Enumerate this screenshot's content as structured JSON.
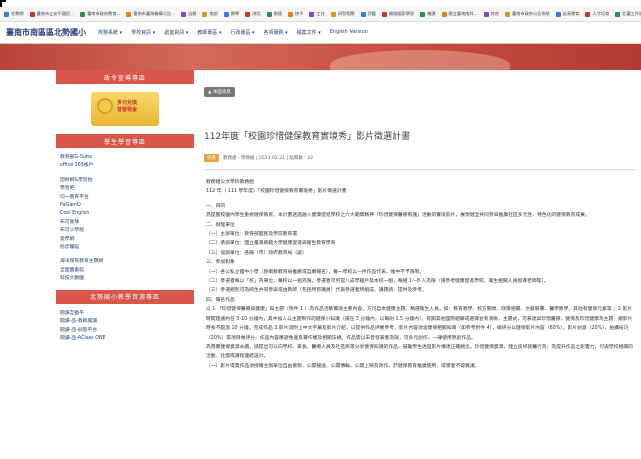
{
  "bookmarks": [
    {
      "label": "北教網"
    },
    {
      "label": "臺南市立安平國民..."
    },
    {
      "label": "臺南市政府教育..."
    },
    {
      "label": "臺南市臺灣機構公告..."
    },
    {
      "label": "自救"
    },
    {
      "label": "南部"
    },
    {
      "label": "教學"
    },
    {
      "label": "湖北"
    },
    {
      "label": "樹德"
    },
    {
      "label": "快平"
    },
    {
      "label": "工作"
    },
    {
      "label": "研習相關"
    },
    {
      "label": "評鑑"
    },
    {
      "label": "開發國家學習"
    },
    {
      "label": "補課"
    },
    {
      "label": "國立臺南南科..."
    },
    {
      "label": "其他"
    },
    {
      "label": "臺南市政府公告系統"
    },
    {
      "label": "延長教育"
    },
    {
      "label": "人才培育"
    },
    {
      "label": "北臺工作區"
    }
  ],
  "site": {
    "title": "臺南市南區區北勢國小",
    "nav": [
      "校務系統 ▾",
      "學校資訊 ▾",
      "處室資訊 ▾",
      "教師專區 ▾",
      "行政專區 ▾",
      "各項服務 ▾",
      "檔案文件 ▾",
      "English Version"
    ]
  },
  "sidebar": {
    "promo_head": "政令宣導專區",
    "promo_text_1": "多元兌換",
    "promo_text_2": "普發現金",
    "learn_head": "學生學習專區",
    "learn_links": [
      "教育部G-Suite",
      "office 365帳戶",
      "",
      "因材網&學習拍",
      "學習吧",
      "均一教育平台",
      "PaGamO",
      "Cool English",
      "布可星球",
      "布可小學版",
      "愛學網",
      "防詐騙館",
      "",
      "海洋保育教育主題網",
      "全國圖書館",
      "科技大觀園"
    ],
    "teacher_head": "北勢國小教學資源專區",
    "teacher_links": [
      "閱讀互動平",
      "閱讀-品-教師閱讀",
      "閱讀-品-創思平台",
      "閱讀-品-AClass ONE"
    ]
  },
  "main": {
    "crumb": "▲ 本區訊息",
    "title": "112年度「校園珍惜健保教育實境秀」影片徵選計畫",
    "tag": "訊息",
    "meta": "教務處 - 學務組 | 2023-02-21 | 點閱數：22",
    "body": [
      "教務組公文學校教務組",
      "112 年（ 111 學年度）「校園珍惜健保教育實境秀」影片徵選計畫",
      "一、目的",
      "為提醒校園內學生重視健保教育，本計畫透過融入健康促進學校之六大範疇精神「珍惜健保醫療照護」活動的實境影片，展現健全共同參與推廣社區多元性、特色化的健保教育成果。",
      "二、辦理單位",
      "（一）主辦單位：教育部國民及學前教育署",
      "（二）承辦單位：國立臺灣師範大學健康促進與衛生教育學系",
      "（三）協辦單位：各縣（市）政府教育局（處）",
      "三、參加對象",
      "（一）各公私立國中小學（除衛教教育局推薦或自願報名），每一學校以一件作品代表，惟中不予限制。",
      "（二）參選者每以「校」為單位，每校以一組為限，參選者可另提八成學籍戶及本校一組，每組 1～8 人為限（請參考健康促進學校、衛生相關人員指導老師等）。",
      "（三）參選組別可為師生共同參與或由教師（包括所有職員）代表參選者所組成，講題請、提供及參考。",
      "四、報名作品",
      "以 1 「珍惜健保醫療與健康」與主題（附件 1 ）為作品活動實境主要內容，方可自本健康主題，精選衛生人員，如：教育教學、校方關懷、政策相關、文藝競賽、醫學教學、其他有健保元素等 ；2.影片時間建議約在 3-10 分鐘內，其中加入以主題製作的健保小知識（請在 3 分鐘內，以每則 1.5 分鐘內），有關其他國際組織或選擇並有清晰，主題式，可表達與珍惜醫療、健保及珍惜健康為主題；總影片時長不超過 10 分鐘，完成作品 3.影片須附上中文字幕及影片介紹，以提供作品評審參考，影片內容須含健保相關知識（如參考附件 4），總評分以健保影片內容（60%），影片創意（20%），拍攝技巧（20%）等項目做評分。作品內容應避免違反著作權及相關法規，作品需以未曾發表者為限，可多元創作，一律使用原創作品。",
      "為落實健保資源永續，請提出可以向學校、家長、醫療人員及社區民眾分享健保知識的作品，鼓勵學生透過影片傳達正確觀念，珍惜健保資源，建立良好就醫行為；為提升作品之影響力，可與學校相關的活動、社團或課程連結設計。",
      "（一）影片得獎作品須授權主辦單位自由重製、公開播送、公開傳輸、公開上映及改作，於健保教育推廣使用，得獎者不得異議。"
    ]
  }
}
